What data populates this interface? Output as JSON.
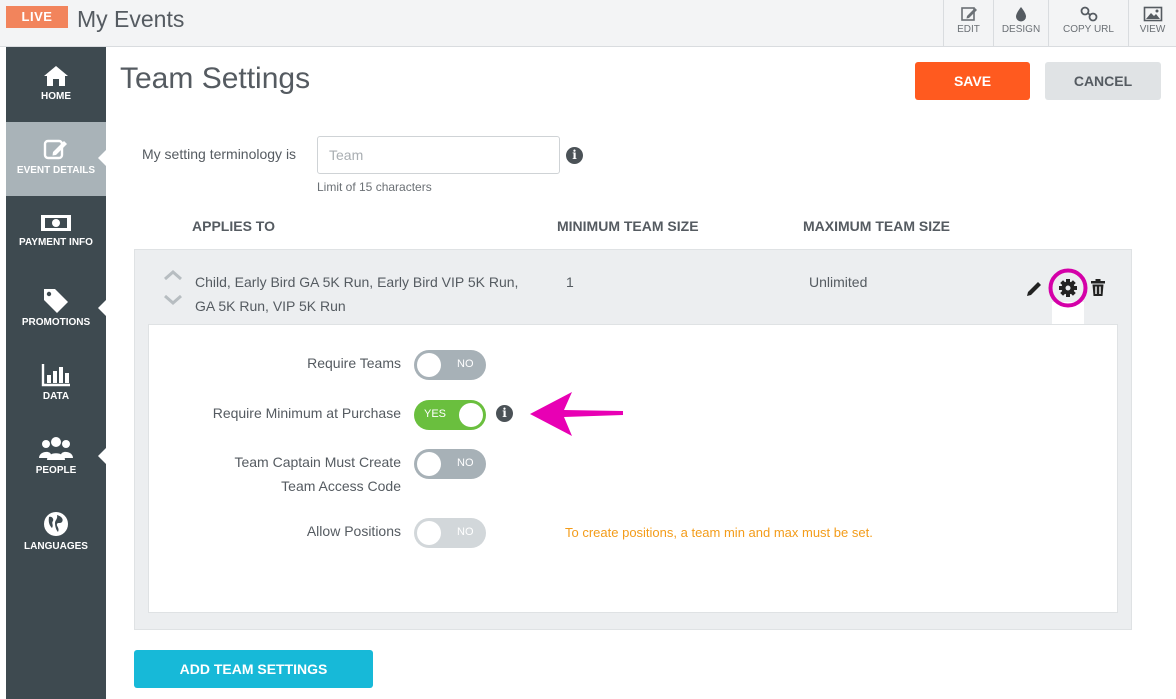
{
  "header": {
    "live_badge": "LIVE",
    "app_title": "My Events",
    "toolbar": [
      {
        "label": "EDIT",
        "icon": "edit-icon"
      },
      {
        "label": "DESIGN",
        "icon": "droplet-icon"
      },
      {
        "label": "COPY URL",
        "icon": "link-icon"
      },
      {
        "label": "VIEW",
        "icon": "image-icon"
      }
    ]
  },
  "sidebar": {
    "items": [
      {
        "label": "HOME",
        "icon": "home-icon"
      },
      {
        "label": "EVENT DETAILS",
        "icon": "edit-icon",
        "active": true
      },
      {
        "label": "PAYMENT INFO",
        "icon": "money-icon"
      },
      {
        "label": "PROMOTIONS",
        "icon": "tag-icon"
      },
      {
        "label": "DATA",
        "icon": "bar-chart-icon"
      },
      {
        "label": "PEOPLE",
        "icon": "people-icon"
      },
      {
        "label": "LANGUAGES",
        "icon": "globe-icon"
      }
    ]
  },
  "page": {
    "title": "Team Settings",
    "save_label": "SAVE",
    "cancel_label": "CANCEL"
  },
  "terminology": {
    "label": "My setting terminology is",
    "placeholder": "Team",
    "value": "",
    "hint": "Limit of 15 characters"
  },
  "table": {
    "headers": [
      "APPLIES TO",
      "MINIMUM TEAM SIZE",
      "MAXIMUM TEAM SIZE"
    ],
    "row": {
      "applies_to_line1": "Child, Early Bird GA 5K Run, Early Bird VIP 5K Run,",
      "applies_to_line2": "GA 5K Run, VIP 5K Run",
      "min": "1",
      "max": "Unlimited"
    }
  },
  "settings": [
    {
      "label": "Require Teams",
      "state": "NO",
      "on": false,
      "disabled": false
    },
    {
      "label": "Require Minimum at Purchase",
      "state": "YES",
      "on": true,
      "disabled": false
    },
    {
      "label_line1": "Team Captain Must Create",
      "label_line2": "Team Access Code",
      "state": "NO",
      "on": false,
      "disabled": false
    },
    {
      "label": "Allow Positions",
      "state": "NO",
      "on": false,
      "disabled": true
    }
  ],
  "warning": "To create positions, a team min and max must be set.",
  "add_button": "ADD TEAM SETTINGS",
  "colors": {
    "live": "#f2845c",
    "sidebar": "#3e4a50",
    "save": "#ff5a1f",
    "add": "#17b9d8",
    "toggle_on": "#6abf3e",
    "warning": "#f39c1a",
    "annotation": "#e800b4"
  }
}
